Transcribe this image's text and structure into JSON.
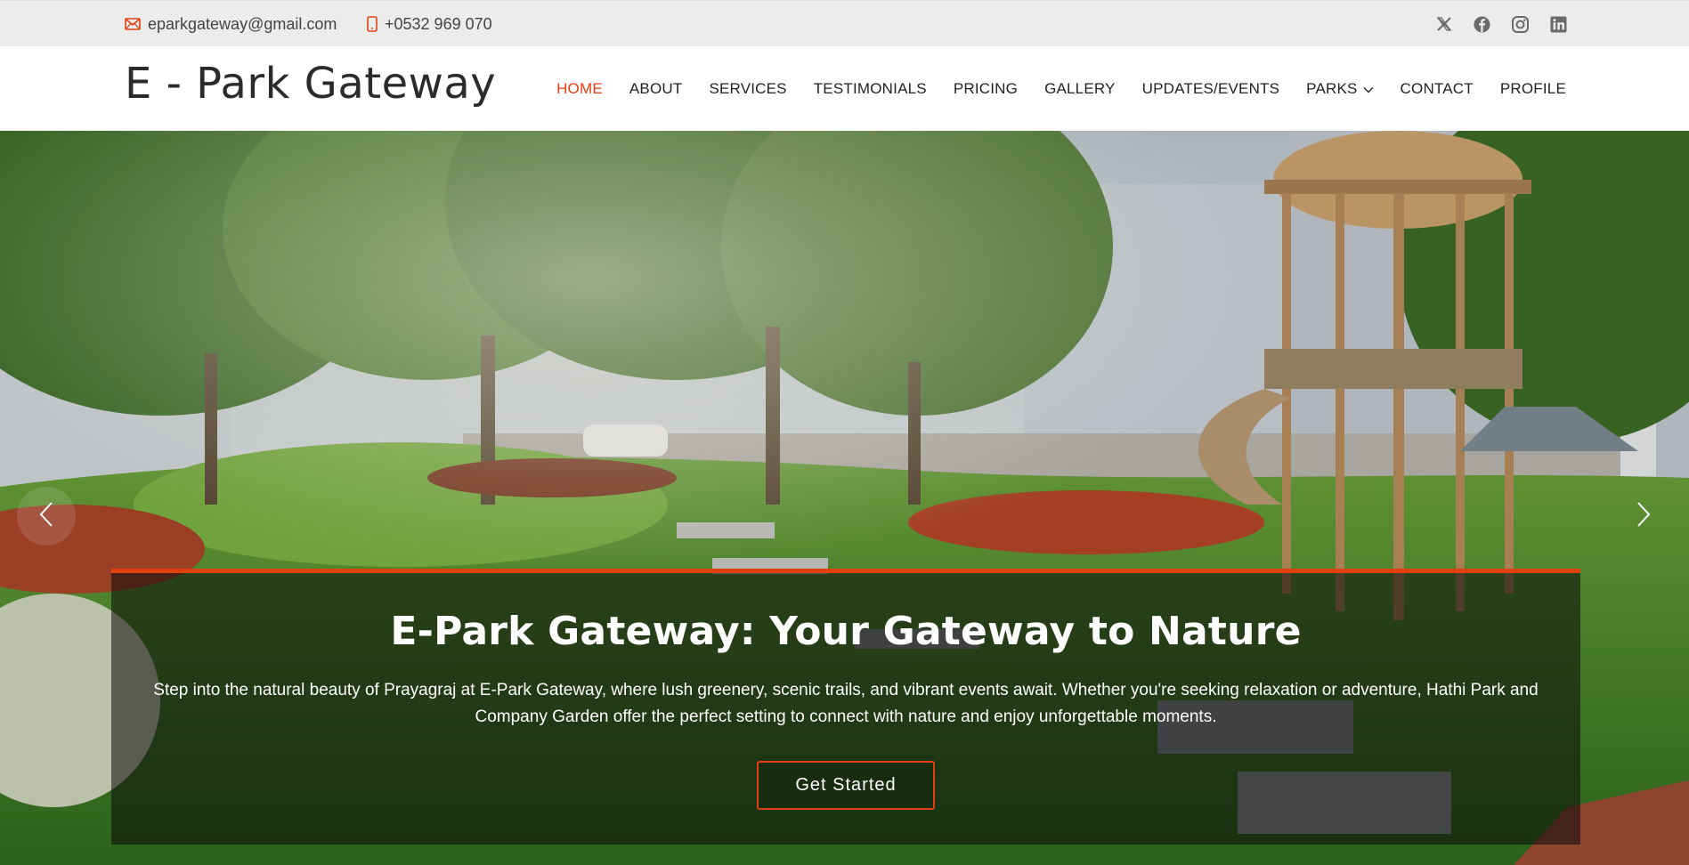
{
  "topbar": {
    "email": "eparkgateway@gmail.com",
    "phone": "+0532 969 070",
    "email_icon": "envelope-icon",
    "phone_icon": "mobile-phone-icon",
    "socials": [
      {
        "name": "twitter-x",
        "icon": "x-icon"
      },
      {
        "name": "facebook",
        "icon": "facebook-icon"
      },
      {
        "name": "instagram",
        "icon": "instagram-icon"
      },
      {
        "name": "linkedin",
        "icon": "linkedin-icon"
      }
    ]
  },
  "header": {
    "logo": "E - Park Gateway",
    "nav": [
      {
        "label": "HOME",
        "active": true
      },
      {
        "label": "ABOUT"
      },
      {
        "label": "SERVICES"
      },
      {
        "label": "TESTIMONIALS"
      },
      {
        "label": "PRICING"
      },
      {
        "label": "GALLERY"
      },
      {
        "label": "UPDATES/EVENTS"
      },
      {
        "label": "PARKS",
        "has_dropdown": true
      },
      {
        "label": "CONTACT"
      },
      {
        "label": "PROFILE"
      }
    ]
  },
  "hero": {
    "title": "E-Park Gateway: Your Gateway to Nature",
    "text": "Step into the natural beauty of Prayagraj at E-Park Gateway, where lush greenery, scenic trails, and vibrant events await. Whether you're seeking relaxation or adventure, Hathi Park and Company Garden offer the perfect setting to connect with nature and enjoy unforgettable moments.",
    "cta_label": "Get Started",
    "prev_icon": "chevron-left-icon",
    "next_icon": "chevron-right-icon"
  },
  "colors": {
    "accent": "#e0400f",
    "topbar_bg": "#ececec",
    "text_dark": "#222222"
  }
}
